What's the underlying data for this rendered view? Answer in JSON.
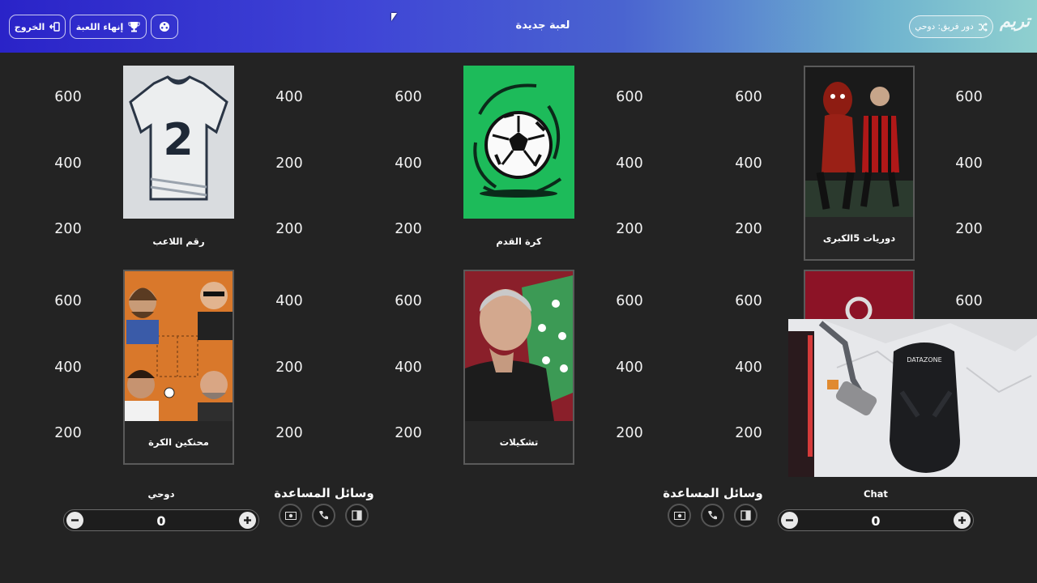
{
  "header": {
    "title": "لعبة جديدة",
    "exit_label": "الخروج",
    "end_game_label": "إنهاء اللعبة",
    "turn_label": "دور فريق: دوحي",
    "logo": "تريم"
  },
  "categories": [
    {
      "label": "رقم اللاعب"
    },
    {
      "label": "كرة القدم"
    },
    {
      "label": "دوريات 5الكبرى"
    },
    {
      "label": "محنكين الكرة"
    },
    {
      "label": "تشكيلات"
    }
  ],
  "point_values": [
    "600",
    "400",
    "200"
  ],
  "help_title": "وسائل المساعدة",
  "teams": [
    {
      "name": "دوحي",
      "score": "0"
    },
    {
      "name": "Chat",
      "score": "0"
    }
  ],
  "webcam_text": "DATAZONE",
  "colors": {
    "accent": "#3f45d6",
    "background": "#232323"
  }
}
